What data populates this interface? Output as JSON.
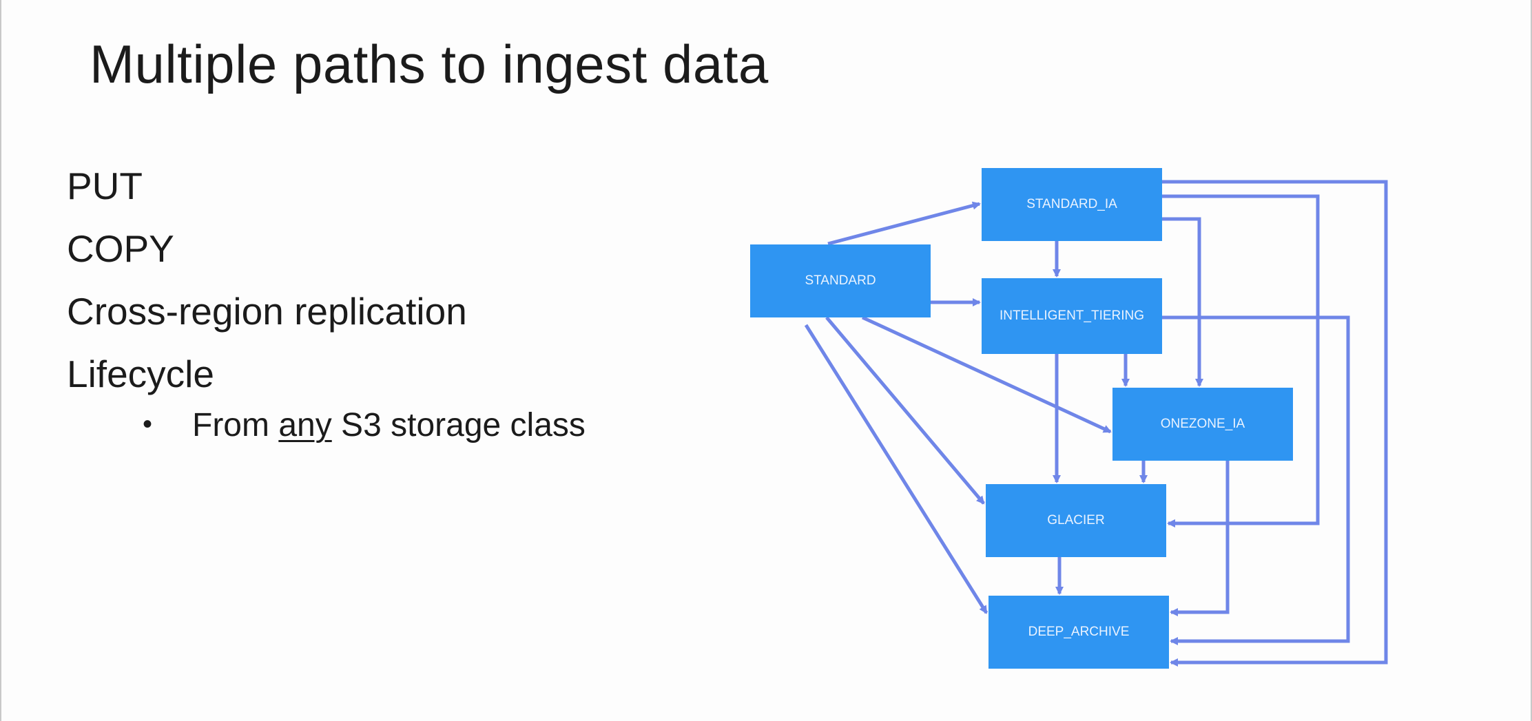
{
  "slide": {
    "title": "Multiple paths to ingest data",
    "bullets": [
      "PUT",
      "COPY",
      "Cross-region replication",
      "Lifecycle"
    ],
    "sub_bullet": {
      "marker": "•",
      "prefix": "From ",
      "emphasis": "any",
      "suffix": " S3 storage class"
    }
  },
  "diagram": {
    "node_color": "#2f95f2",
    "edge_color": "#6f86e8",
    "nodes": [
      {
        "id": "standard",
        "label": "STANDARD"
      },
      {
        "id": "standard_ia",
        "label": "STANDARD_IA"
      },
      {
        "id": "intelligent_tiering",
        "label": "INTELLIGENT_TIERING"
      },
      {
        "id": "onezone_ia",
        "label": "ONEZONE_IA"
      },
      {
        "id": "glacier",
        "label": "GLACIER"
      },
      {
        "id": "deep_archive",
        "label": "DEEP_ARCHIVE"
      }
    ],
    "edges": [
      {
        "from": "standard",
        "to": "standard_ia"
      },
      {
        "from": "standard",
        "to": "intelligent_tiering"
      },
      {
        "from": "standard",
        "to": "onezone_ia"
      },
      {
        "from": "standard",
        "to": "glacier"
      },
      {
        "from": "standard",
        "to": "deep_archive"
      },
      {
        "from": "standard_ia",
        "to": "intelligent_tiering"
      },
      {
        "from": "standard_ia",
        "to": "onezone_ia"
      },
      {
        "from": "standard_ia",
        "to": "glacier"
      },
      {
        "from": "standard_ia",
        "to": "deep_archive"
      },
      {
        "from": "intelligent_tiering",
        "to": "onezone_ia"
      },
      {
        "from": "intelligent_tiering",
        "to": "glacier"
      },
      {
        "from": "intelligent_tiering",
        "to": "deep_archive"
      },
      {
        "from": "onezone_ia",
        "to": "glacier"
      },
      {
        "from": "onezone_ia",
        "to": "deep_archive"
      },
      {
        "from": "glacier",
        "to": "deep_archive"
      }
    ]
  }
}
